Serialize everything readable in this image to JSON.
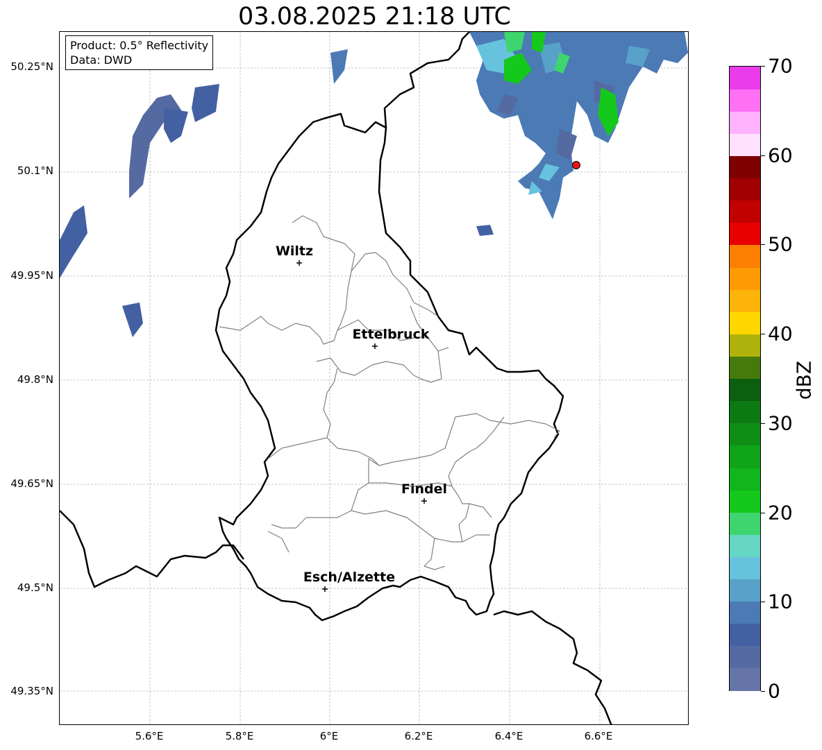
{
  "title": "03.08.2025 21:18 UTC",
  "info": {
    "product": "Product: 0.5° Reflectivity",
    "data": "Data: DWD"
  },
  "lat_labels": [
    "50.25°N",
    "50.1°N",
    "49.95°N",
    "49.8°N",
    "49.65°N",
    "49.5°N",
    "49.35°N"
  ],
  "lon_labels": [
    "5.6°E",
    "5.8°E",
    "6°E",
    "6.2°E",
    "6.4°E",
    "6.6°E"
  ],
  "cities": [
    {
      "name": "Wiltz",
      "lon": 5.93,
      "lat": 49.967
    },
    {
      "name": "Ettelbruck",
      "lon": 6.1,
      "lat": 49.847
    },
    {
      "name": "Findel",
      "lon": 6.21,
      "lat": 49.624
    },
    {
      "name": "Esch/Alzette",
      "lon": 5.99,
      "lat": 49.497
    }
  ],
  "radar_site": {
    "lon": 6.548,
    "lat": 50.11,
    "color": "#e8131b"
  },
  "colorbar": {
    "label": "dBZ",
    "ticks": [
      "0",
      "10",
      "20",
      "30",
      "40",
      "50",
      "60",
      "70"
    ],
    "min": 0,
    "max": 70,
    "colors": [
      "#6675a8",
      "#556aa1",
      "#4361a2",
      "#4b7ab5",
      "#58a1c9",
      "#67c3dd",
      "#65d6c3",
      "#3fd56e",
      "#14c91c",
      "#12b51b",
      "#10a419",
      "#0f8e16",
      "#0c7a13",
      "#0b5f0f",
      "#467a0d",
      "#afb20a",
      "#ffd700",
      "#fdb409",
      "#fd9a05",
      "#fd7f02",
      "#e80000",
      "#c10000",
      "#a00000",
      "#7e0000",
      "#ffe0ff",
      "#ffb3ff",
      "#ff70f5",
      "#ea3ceb"
    ]
  }
}
